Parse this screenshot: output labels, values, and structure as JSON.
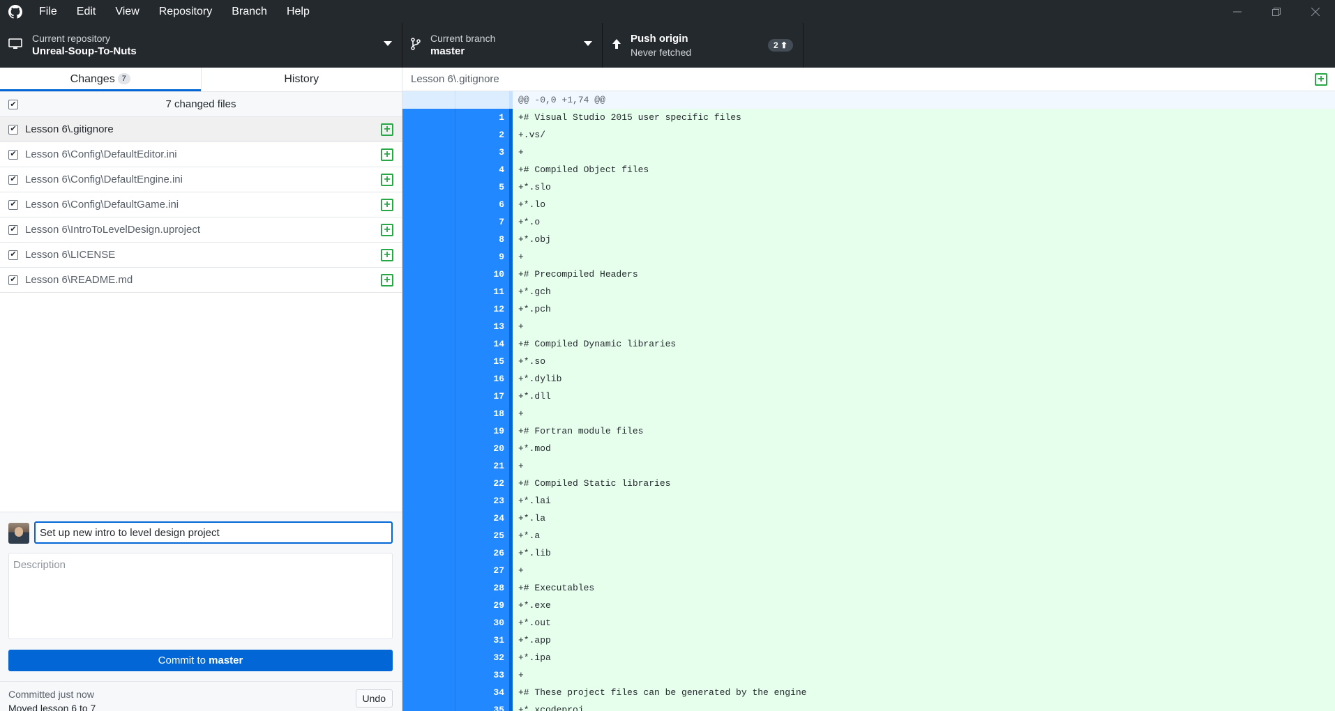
{
  "menu": [
    "File",
    "Edit",
    "View",
    "Repository",
    "Branch",
    "Help"
  ],
  "toolbar": {
    "repo_label": "Current repository",
    "repo_name": "Unreal-Soup-To-Nuts",
    "branch_label": "Current branch",
    "branch_name": "master",
    "push_label": "Push origin",
    "push_sub": "Never fetched",
    "push_count": "2 ⬆"
  },
  "tabs": {
    "changes": "Changes",
    "changes_count": "7",
    "history": "History"
  },
  "files_header": "7 changed files",
  "files": [
    "Lesson 6\\.gitignore",
    "Lesson 6\\Config\\DefaultEditor.ini",
    "Lesson 6\\Config\\DefaultEngine.ini",
    "Lesson 6\\Config\\DefaultGame.ini",
    "Lesson 6\\IntroToLevelDesign.uproject",
    "Lesson 6\\LICENSE",
    "Lesson 6\\README.md"
  ],
  "commit": {
    "summary_value": "Set up new intro to level design project",
    "description_placeholder": "Description",
    "button_prefix": "Commit to",
    "button_branch": "master"
  },
  "undo": {
    "line1": "Committed just now",
    "line2": "Moved lesson 6 to 7",
    "button": "Undo"
  },
  "diff": {
    "file": "Lesson 6\\.gitignore",
    "hunk": "@@ -0,0 +1,74 @@",
    "lines": [
      "+# Visual Studio 2015 user specific files",
      "+.vs/",
      "+",
      "+# Compiled Object files",
      "+*.slo",
      "+*.lo",
      "+*.o",
      "+*.obj",
      "+",
      "+# Precompiled Headers",
      "+*.gch",
      "+*.pch",
      "+",
      "+# Compiled Dynamic libraries",
      "+*.so",
      "+*.dylib",
      "+*.dll",
      "+",
      "+# Fortran module files",
      "+*.mod",
      "+",
      "+# Compiled Static libraries",
      "+*.lai",
      "+*.la",
      "+*.a",
      "+*.lib",
      "+",
      "+# Executables",
      "+*.exe",
      "+*.out",
      "+*.app",
      "+*.ipa",
      "+",
      "+# These project files can be generated by the engine",
      "+*.xcodeproj"
    ]
  }
}
